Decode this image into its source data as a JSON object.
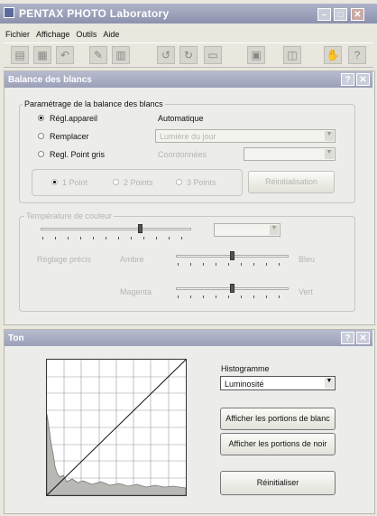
{
  "app": {
    "title": "PENTAX PHOTO Laboratory"
  },
  "menu": [
    "Fichier",
    "Affichage",
    "Outils",
    "Aide"
  ],
  "toolbar_icons": [
    "open-icon",
    "save-icon",
    "undo-icon",
    "magic-wand-icon",
    "print-icon",
    "rotate-left-icon",
    "rotate-right-icon",
    "view-icon",
    "jpeg-icon",
    "compare-icon",
    "hand-icon",
    "help-icon"
  ],
  "wb": {
    "title": "Balance des blancs",
    "help": "?",
    "close": "✕",
    "group_title": "Paramétrage de la balance des blancs",
    "radio_camera": "Régl.appareil",
    "camera_value": "Automatique",
    "radio_replace": "Remplacer",
    "replace_value": "Lumière du jour",
    "radio_gray": "Regl. Point gris",
    "coords_label": "Coordonnées",
    "point1": "1 Point",
    "point2": "2 Points",
    "point3": "3 Points",
    "reinit": "Réinitialisation",
    "temp_group": "Température de couleur",
    "fine_label": "Réglage précis",
    "amber": "Ambre",
    "blue": "Bleu",
    "magenta": "Magenta",
    "green": "Vert"
  },
  "tone": {
    "title": "Ton",
    "help": "?",
    "close": "✕",
    "histo_label": "Histogramme",
    "histo_value": "Luminosité",
    "white_btn": "Afficher les portions de blanc",
    "black_btn": "Afficher les portions de noir",
    "reset_btn": "Réinitialiser"
  }
}
